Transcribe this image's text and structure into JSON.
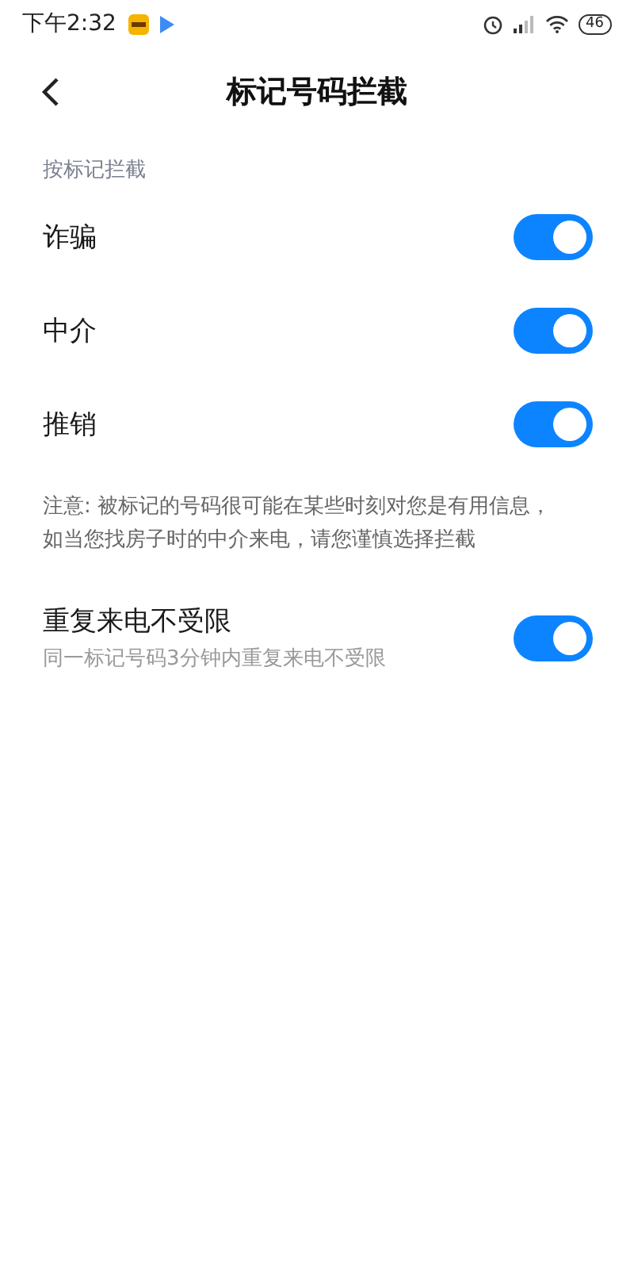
{
  "status_bar": {
    "time": "下午2:32",
    "battery": "46"
  },
  "header": {
    "title": "标记号码拦截"
  },
  "section": {
    "label": "按标记拦截"
  },
  "items": [
    {
      "label": "诈骗",
      "on": true
    },
    {
      "label": "中介",
      "on": true
    },
    {
      "label": "推销",
      "on": true
    }
  ],
  "note": "注意: 被标记的号码很可能在某些时刻对您是有用信息，如当您找房子时的中介来电，请您谨慎选择拦截",
  "repeat": {
    "label": "重复来电不受限",
    "description": "同一标记号码3分钟内重复来电不受限",
    "on": true
  }
}
